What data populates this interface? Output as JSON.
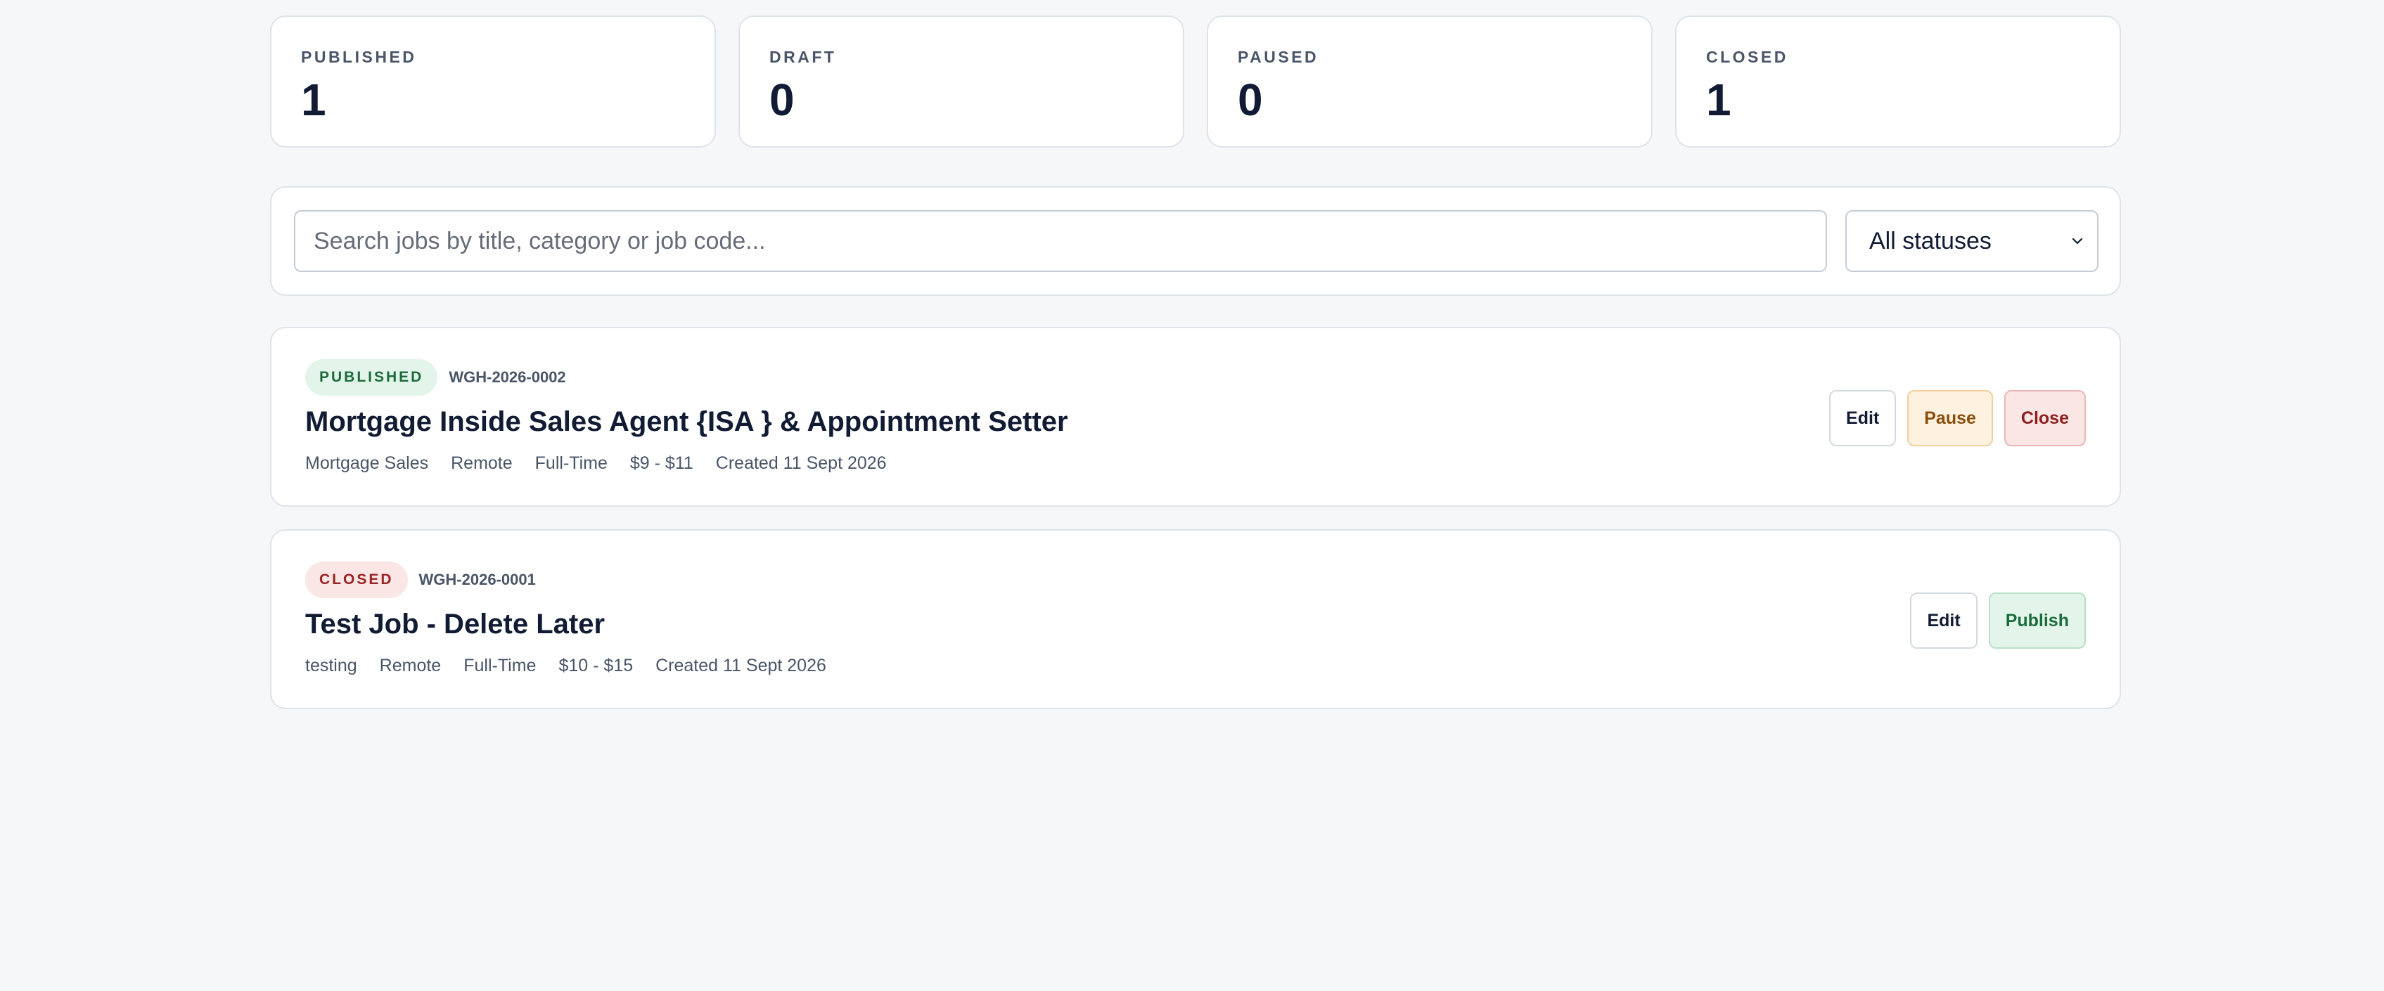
{
  "stats": [
    {
      "label": "PUBLISHED",
      "value": "1"
    },
    {
      "label": "DRAFT",
      "value": "0"
    },
    {
      "label": "PAUSED",
      "value": "0"
    },
    {
      "label": "CLOSED",
      "value": "1"
    }
  ],
  "search": {
    "placeholder": "Search jobs by title, category or job code...",
    "value": "",
    "status_selected": "All statuses"
  },
  "jobs": [
    {
      "status": "PUBLISHED",
      "code": "WGH-2026-0002",
      "title": "Mortgage Inside Sales Agent {ISA } & Appointment Setter",
      "category": "Mortgage Sales",
      "location": "Remote",
      "type": "Full-Time",
      "pay": "$9 - $11",
      "created": "Created 11 Sept 2026",
      "actions": {
        "edit": "Edit",
        "pause": "Pause",
        "close": "Close"
      }
    },
    {
      "status": "CLOSED",
      "code": "WGH-2026-0001",
      "title": "Test Job - Delete Later",
      "category": "testing",
      "location": "Remote",
      "type": "Full-Time",
      "pay": "$10 - $15",
      "created": "Created 11 Sept 2026",
      "actions": {
        "edit": "Edit",
        "publish": "Publish"
      }
    }
  ],
  "colors": {
    "background": "#f6f7f9",
    "text": "#111b33",
    "published_badge": "#e3f5ea",
    "closed_badge": "#fbe6e6",
    "pause_button": "#fdf1e0"
  },
  "icons": {
    "status_select": "chevron-down-icon"
  }
}
